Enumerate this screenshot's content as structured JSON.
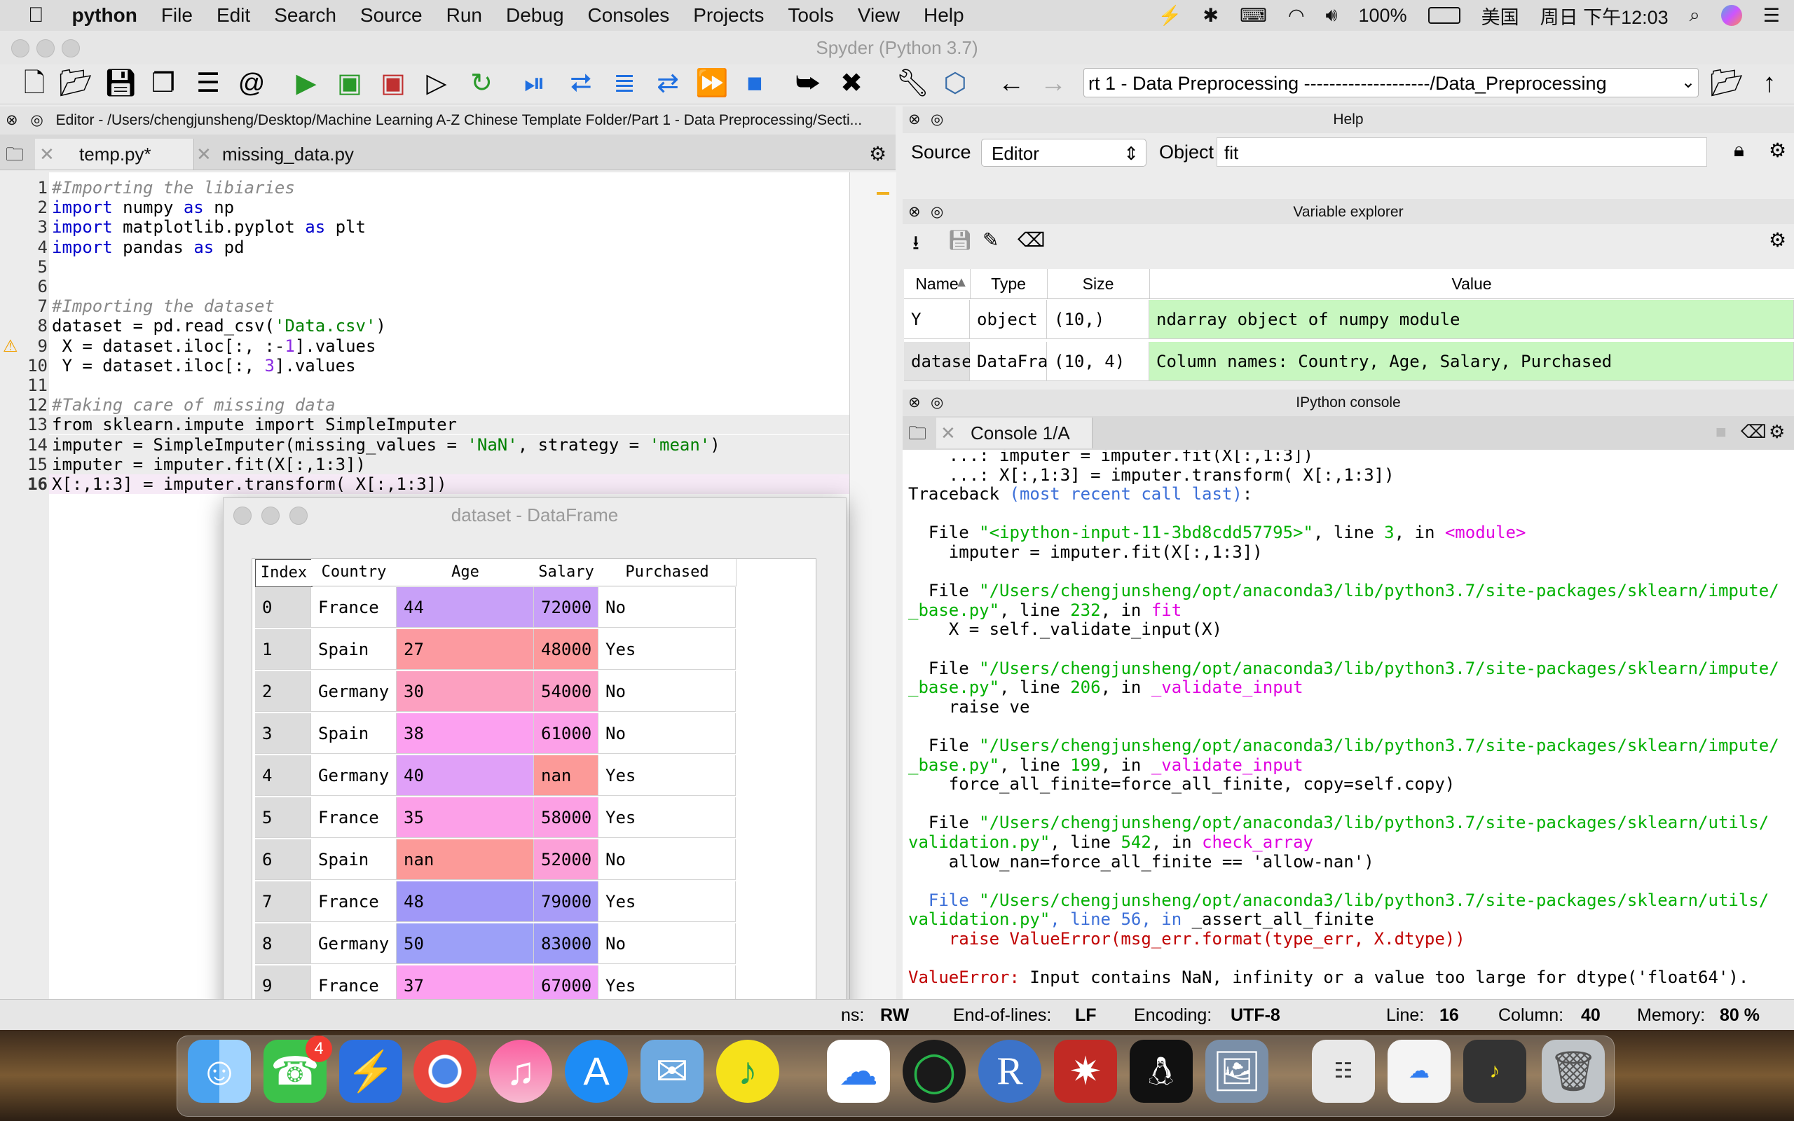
{
  "menubar": {
    "app": "python",
    "items": [
      "File",
      "Edit",
      "Search",
      "Source",
      "Run",
      "Debug",
      "Consoles",
      "Projects",
      "Tools",
      "View",
      "Help"
    ],
    "battery": "100%",
    "input_method": "美国",
    "clock": "周日 下午12:03"
  },
  "window": {
    "title": "Spyder (Python 3.7)"
  },
  "toolbar": {
    "path": "rt 1 - Data Preprocessing --------------------/Data_Preprocessing"
  },
  "editor": {
    "header": "Editor - /Users/chengjunsheng/Desktop/Machine Learning A-Z Chinese Template Folder/Part 1 - Data Preprocessing/Secti...",
    "tabs": [
      "temp.py*",
      "missing_data.py"
    ],
    "lines": [
      "#Importing the libiaries",
      "import numpy as np",
      "import matplotlib.pyplot as plt",
      "import pandas as pd",
      "",
      "",
      "#Importing the dataset",
      "dataset = pd.read_csv('Data.csv')",
      " X = dataset.iloc[:, :-1].values",
      " Y = dataset.iloc[:, 3].values",
      "",
      "#Taking care of missing data",
      "from sklearn.impute import SimpleImputer",
      "imputer = SimpleImputer(missing_values = 'NaN', strategy = 'mean')",
      "imputer = imputer.fit(X[:,1:3])",
      "X[:,1:3] = imputer.transform( X[:,1:3])"
    ],
    "line_numbers": [
      "1",
      "2",
      "3",
      "4",
      "5",
      "6",
      "7",
      "8",
      "9",
      "10",
      "11",
      "12",
      "13",
      "14",
      "15",
      "16"
    ]
  },
  "dataframe": {
    "title": "dataset - DataFrame",
    "columns": [
      "Index",
      "Country",
      "Age",
      "Salary",
      "Purchased"
    ],
    "rows": [
      [
        "0",
        "France",
        "44",
        "72000",
        "No"
      ],
      [
        "1",
        "Spain",
        "27",
        "48000",
        "Yes"
      ],
      [
        "2",
        "Germany",
        "30",
        "54000",
        "No"
      ],
      [
        "3",
        "Spain",
        "38",
        "61000",
        "No"
      ],
      [
        "4",
        "Germany",
        "40",
        "nan",
        "Yes"
      ],
      [
        "5",
        "France",
        "35",
        "58000",
        "Yes"
      ],
      [
        "6",
        "Spain",
        "nan",
        "52000",
        "No"
      ],
      [
        "7",
        "France",
        "48",
        "79000",
        "Yes"
      ],
      [
        "8",
        "Germany",
        "50",
        "83000",
        "No"
      ],
      [
        "9",
        "France",
        "37",
        "67000",
        "Yes"
      ]
    ],
    "age_colors": [
      "#c8a0f8",
      "#fc9aa0",
      "#fca0c0",
      "#fca0f0",
      "#e0a0f8",
      "#fca0e8",
      "#fc9a98",
      "#a098f8",
      "#9ca0f8",
      "#fca0f0"
    ],
    "salary_colors": [
      "#c8a0f8",
      "#fc9a9c",
      "#fca0c8",
      "#fca0e8",
      "#fc9a98",
      "#fca0e4",
      "#fca0d8",
      "#a89cf8",
      "#9c9cf8",
      "#f0a0f8"
    ]
  },
  "help": {
    "title": "Help",
    "source_label": "Source",
    "source_value": "Editor",
    "object_label": "Object",
    "object_value": "fit"
  },
  "variable_explorer": {
    "title": "Variable explorer",
    "columns": [
      "Name",
      "Type",
      "Size",
      "Value"
    ],
    "rows": [
      [
        "Y",
        "object",
        "(10,)",
        "ndarray object of numpy module"
      ],
      [
        "dataset",
        "DataFrame",
        "(10, 4)",
        "Column names: Country, Age, Salary, Purchased"
      ]
    ]
  },
  "console": {
    "title": "IPython console",
    "tab": "Console 1/A",
    "lines": [
      "    ...: imputer = imputer.fit(X[:,1:3])",
      "    ...: X[:,1:3] = imputer.transform( X[:,1:3])",
      "Traceback (most recent call last):",
      "",
      "  File \"<ipython-input-11-3bd8cdd57795>\", line 3, in <module>",
      "    imputer = imputer.fit(X[:,1:3])",
      "",
      "  File \"/Users/chengjunsheng/opt/anaconda3/lib/python3.7/site-packages/sklearn/impute/",
      "_base.py\", line 232, in fit",
      "    X = self._validate_input(X)",
      "",
      "  File \"/Users/chengjunsheng/opt/anaconda3/lib/python3.7/site-packages/sklearn/impute/",
      "_base.py\", line 206, in _validate_input",
      "    raise ve",
      "",
      "  File \"/Users/chengjunsheng/opt/anaconda3/lib/python3.7/site-packages/sklearn/impute/",
      "_base.py\", line 199, in _validate_input",
      "    force_all_finite=force_all_finite, copy=self.copy)",
      "",
      "  File \"/Users/chengjunsheng/opt/anaconda3/lib/python3.7/site-packages/sklearn/utils/",
      "validation.py\", line 542, in check_array",
      "    allow_nan=force_all_finite == 'allow-nan')",
      "",
      "  File \"/Users/chengjunsheng/opt/anaconda3/lib/python3.7/site-packages/sklearn/utils/",
      "validation.py\", line 56, in _assert_all_finite",
      "    raise ValueError(msg_err.format(type_err, X.dtype))",
      "",
      "ValueError: Input contains NaN, infinity or a value too large for dtype('float64')."
    ]
  },
  "status": {
    "perm_label": "ns:",
    "perm_value": "RW",
    "eol_label": "End-of-lines:",
    "eol_value": "LF",
    "enc_label": "Encoding:",
    "enc_value": "UTF-8",
    "line_label": "Line:",
    "line_value": "16",
    "col_label": "Column:",
    "col_value": "40",
    "mem_label": "Memory:",
    "mem_value": "80 %"
  },
  "dock": {
    "facetime_badge": "4"
  }
}
